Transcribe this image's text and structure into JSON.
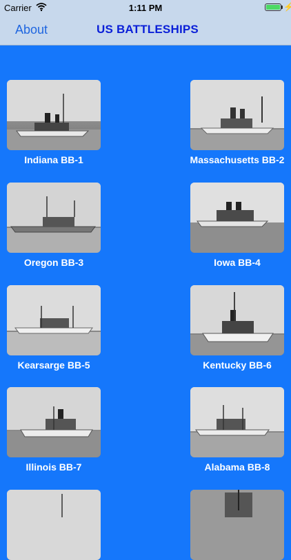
{
  "status_bar": {
    "carrier": "Carrier",
    "time": "1:11 PM"
  },
  "nav": {
    "about_label": "About",
    "title": "US BATTLESHIPS"
  },
  "ships": [
    {
      "label": "Indiana BB-1"
    },
    {
      "label": "Massachusetts BB-2"
    },
    {
      "label": "Oregon BB-3"
    },
    {
      "label": "Iowa BB-4"
    },
    {
      "label": "Kearsarge BB-5"
    },
    {
      "label": "Kentucky BB-6"
    },
    {
      "label": "Illinois BB-7"
    },
    {
      "label": "Alabama BB-8"
    },
    {
      "label": ""
    },
    {
      "label": ""
    }
  ],
  "colors": {
    "background": "#1577fb",
    "nav_bar": "#c7d8ec",
    "title": "#0a1fd8",
    "about": "#1f66e0"
  },
  "icons": {
    "wifi": "wifi-icon",
    "battery": "battery-icon"
  }
}
